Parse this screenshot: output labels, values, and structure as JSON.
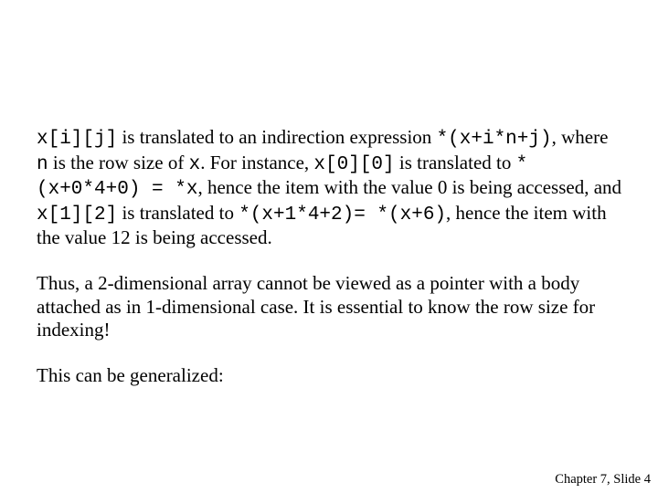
{
  "body": {
    "p1": {
      "c1": "x[i][j]",
      "t1": " is translated to an indirection expression ",
      "c2": "*(x+i*n+j)",
      "t2": ", where ",
      "c3": "n",
      "t3": " is the row size of ",
      "c4": "x",
      "t4": ". For instance, ",
      "c5": "x[0][0]",
      "t5": " is translated to ",
      "c6": "*(x+0*4+0) = *x",
      "t6": ", hence the item with the value 0 is being accessed, and ",
      "c7": "x[1][2]",
      "t7": " is translated to ",
      "c8": "*(x+1*4+2)= *(x+6)",
      "t8": ", hence the item with the value 12 is being accessed."
    },
    "p2": "Thus, a 2-dimensional array cannot be viewed as a pointer with a body attached as in 1-dimensional case. It is essential to know the row size for indexing!",
    "p3": "This can be generalized:"
  },
  "footer": "Chapter 7, Slide 4"
}
